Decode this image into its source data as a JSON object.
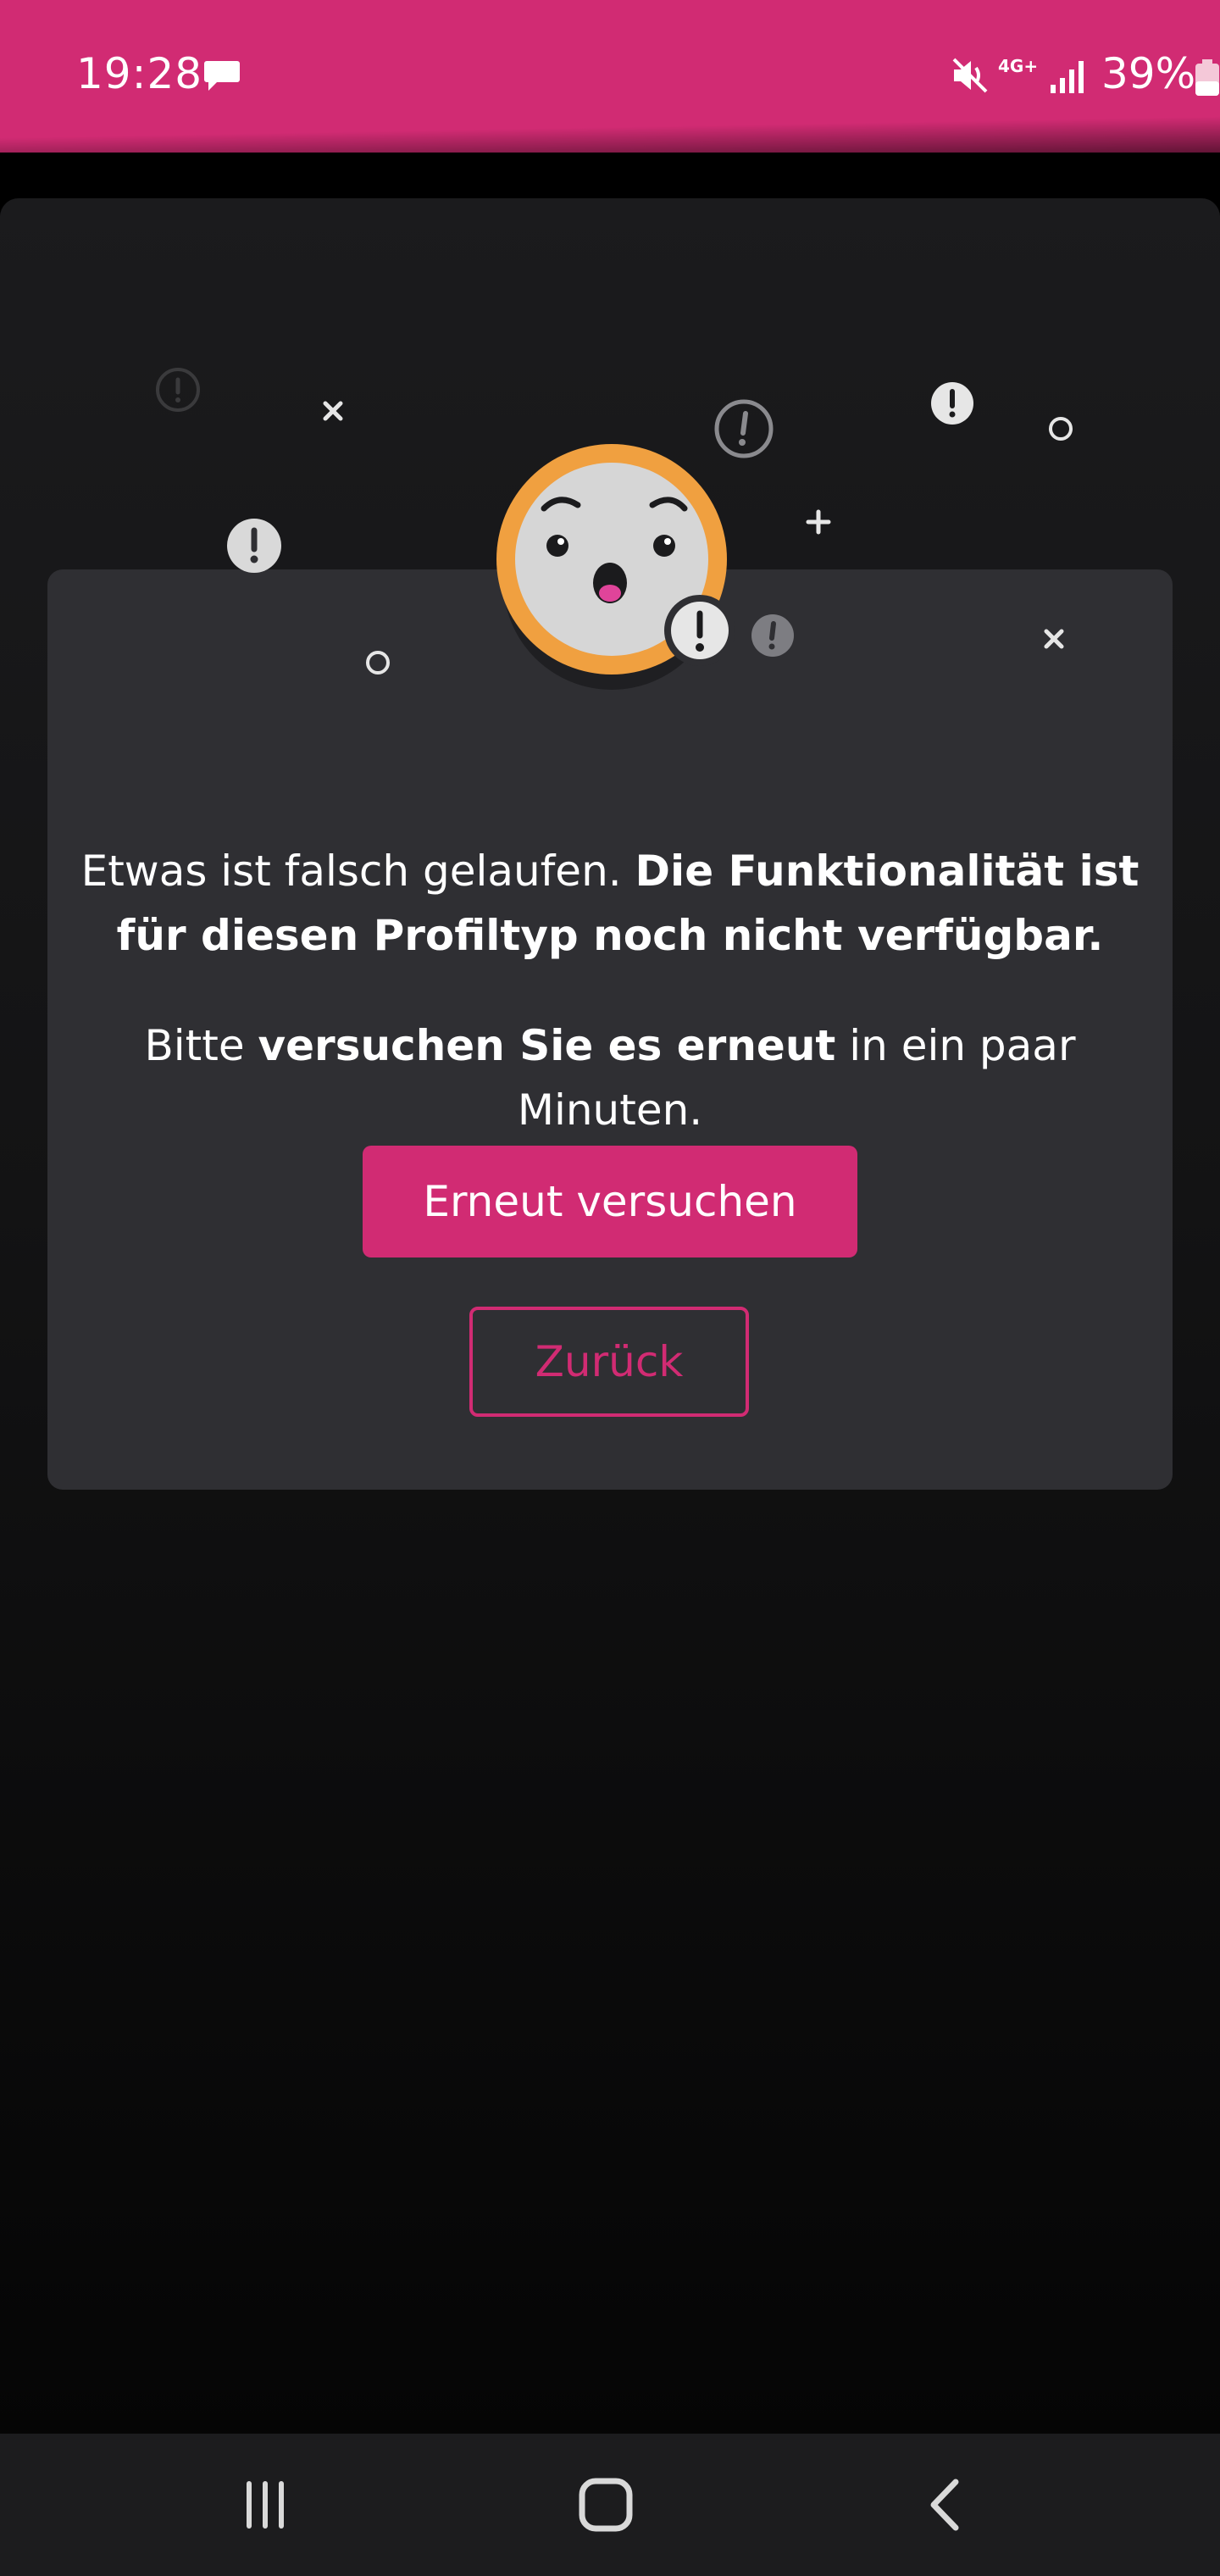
{
  "status_bar": {
    "time": "19:28",
    "network": "4G+",
    "battery_percent": "39%",
    "battery_level": 0.39,
    "background_color": "#d12b73"
  },
  "error": {
    "line1_normal": "Etwas ist falsch gelaufen. ",
    "line1_bold": "Die Funktionalität ist für diesen Profiltyp noch nicht verfügbar.",
    "line2_prefix": "Bitte ",
    "line2_bold": "versuchen Sie es erneut",
    "line2_suffix": " in ein paar Minuten."
  },
  "buttons": {
    "retry_label": "Erneut versuchen",
    "back_label": "Zurück"
  },
  "colors": {
    "accent": "#d12b73",
    "card": "#2f2f33",
    "face_ring": "#f0a040"
  },
  "icons": {
    "status": [
      "message-icon",
      "mute-icon",
      "signal-icon",
      "battery-icon"
    ],
    "illustration": "surprised-face-icon",
    "navigation": [
      "recent-apps-icon",
      "home-icon",
      "back-icon"
    ]
  }
}
